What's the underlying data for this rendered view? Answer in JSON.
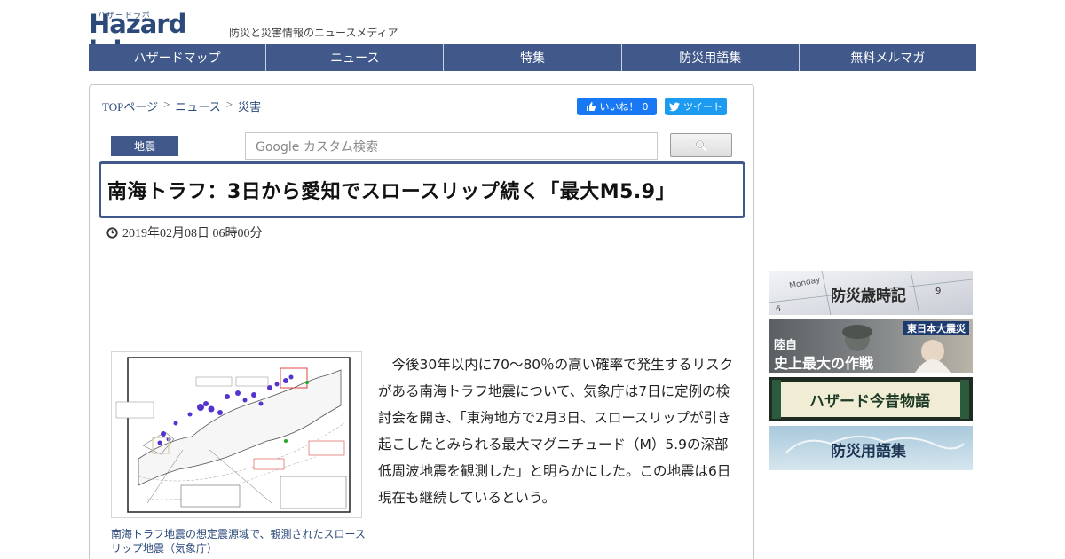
{
  "header": {
    "logo_kana": "ハザードラボ",
    "logo_text": "Hazard lab",
    "tagline": "防災と災害情報のニュースメディア"
  },
  "nav": [
    "ハザードマップ",
    "ニュース",
    "特集",
    "防災用語集",
    "無料メルマガ"
  ],
  "breadcrumb": {
    "home": "TOPページ",
    "section": "ニュース",
    "current": "災害",
    "separator": ">"
  },
  "social": {
    "like_label": "いいね！",
    "like_count": "0",
    "tweet_label": "ツイート"
  },
  "category": "地震",
  "search": {
    "placeholder": "Google カスタム検索"
  },
  "article": {
    "title": "南海トラフ：3日から愛知でスロースリップ続く「最大M5.9」",
    "date": "2019年02月08日 06時00分",
    "caption": "南海トラフ地震の想定震源域で、観測されたスロースリップ地震（気象庁）",
    "body": "今後30年以内に70〜80％の高い確率で発生するリスクがある南海トラフ地震について、気象庁は7日に定例の検討会を開き、「東海地方で2月3日、スロースリップが引き起こしたとみられる最大マグニチュード（M）5.9の深部低周波地震を観測した」と明らかにした。この地震は6日現在も継続しているという。"
  },
  "sidebar": {
    "banner1": "防災歳時記",
    "banner2_tag": "東日本大震災",
    "banner2_line1": "陸自",
    "banner2_line2": "史上最大の作戦",
    "banner3": "ハザード今昔物語",
    "banner4": "防災用語集"
  },
  "colors": {
    "brand": "#40598a",
    "link": "#2b4a7a",
    "facebook": "#1877f2",
    "twitter": "#1d9bf0"
  },
  "icons": [
    "clock-icon",
    "search-icon",
    "thumbs-up-icon",
    "twitter-bird-icon"
  ]
}
